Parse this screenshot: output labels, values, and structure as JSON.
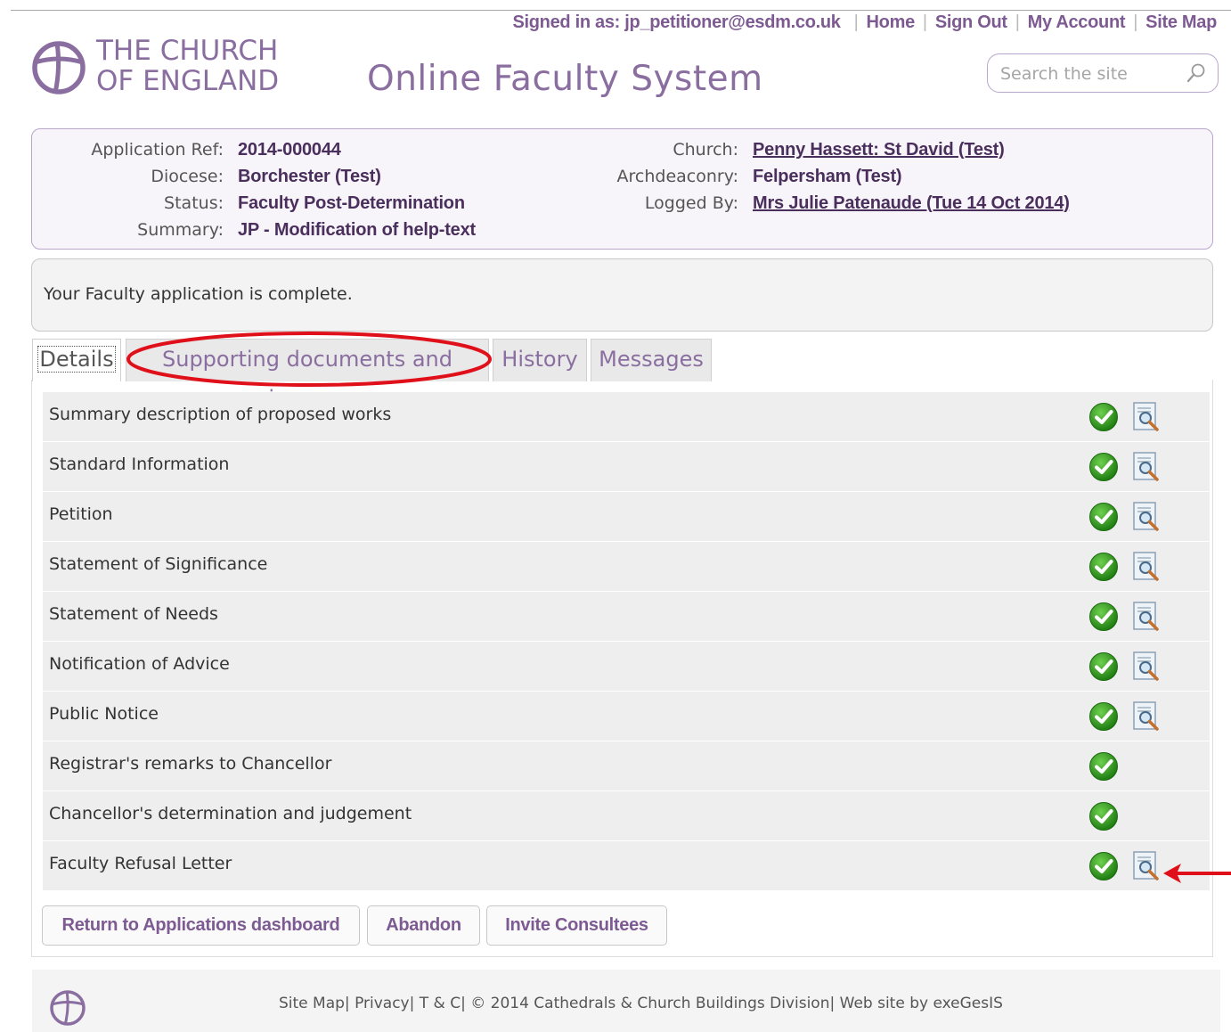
{
  "header": {
    "signed_in": "Signed in as: jp_petitioner@esdm.co.uk",
    "nav": [
      "Home",
      "Sign Out",
      "My Account",
      "Site Map"
    ],
    "logo_line1": "THE CHURCH",
    "logo_line2": "OF ENGLAND",
    "site_title": "Online Faculty System",
    "search_placeholder": "Search the site"
  },
  "application": {
    "ref_label": "Application Ref:",
    "ref": "2014-000044",
    "diocese_label": "Diocese:",
    "diocese": "Borchester (Test)",
    "status_label": "Status:",
    "status": "Faculty Post-Determination",
    "summary_label": "Summary:",
    "summary": "JP - Modification of help-text",
    "church_label": "Church:",
    "church": "Penny Hassett: St David (Test)",
    "archdeaconry_label": "Archdeaconry:",
    "archdeaconry": "Felpersham (Test)",
    "logged_by_label": "Logged By:",
    "logged_by": "Mrs Julie Patenaude (Tue 14 Oct 2014)"
  },
  "message": "Your Faculty application is complete.",
  "tabs": [
    "Details",
    "Supporting documents and images",
    "History",
    "Messages"
  ],
  "sections": [
    {
      "label": "Summary description of proposed works",
      "complete": true,
      "viewable": true
    },
    {
      "label": "Standard Information",
      "complete": true,
      "viewable": true
    },
    {
      "label": "Petition",
      "complete": true,
      "viewable": true
    },
    {
      "label": "Statement of Significance",
      "complete": true,
      "viewable": true
    },
    {
      "label": "Statement of Needs",
      "complete": true,
      "viewable": true
    },
    {
      "label": "Notification of Advice",
      "complete": true,
      "viewable": true
    },
    {
      "label": "Public Notice",
      "complete": true,
      "viewable": true
    },
    {
      "label": "Registrar's remarks to Chancellor",
      "complete": true,
      "viewable": false
    },
    {
      "label": "Chancellor's determination and judgement",
      "complete": true,
      "viewable": false
    },
    {
      "label": "Faculty Refusal Letter",
      "complete": true,
      "viewable": true
    }
  ],
  "buttons": {
    "return": "Return to Applications dashboard",
    "abandon": "Abandon",
    "invite": "Invite Consultees"
  },
  "footer": {
    "links": [
      "Site Map",
      "Privacy",
      "T & C",
      "© 2014 Cathedrals & Church Buildings Division",
      "Web site by exeGesIS"
    ]
  },
  "colors": {
    "brand_purple": "#8a6ea0",
    "link_purple": "#7d5a92",
    "annotation_red": "#e0101a",
    "check_green": "#2e9a1e"
  },
  "icons": {
    "complete": "green-check-icon",
    "view": "document-magnifier-icon",
    "search": "search-icon"
  }
}
